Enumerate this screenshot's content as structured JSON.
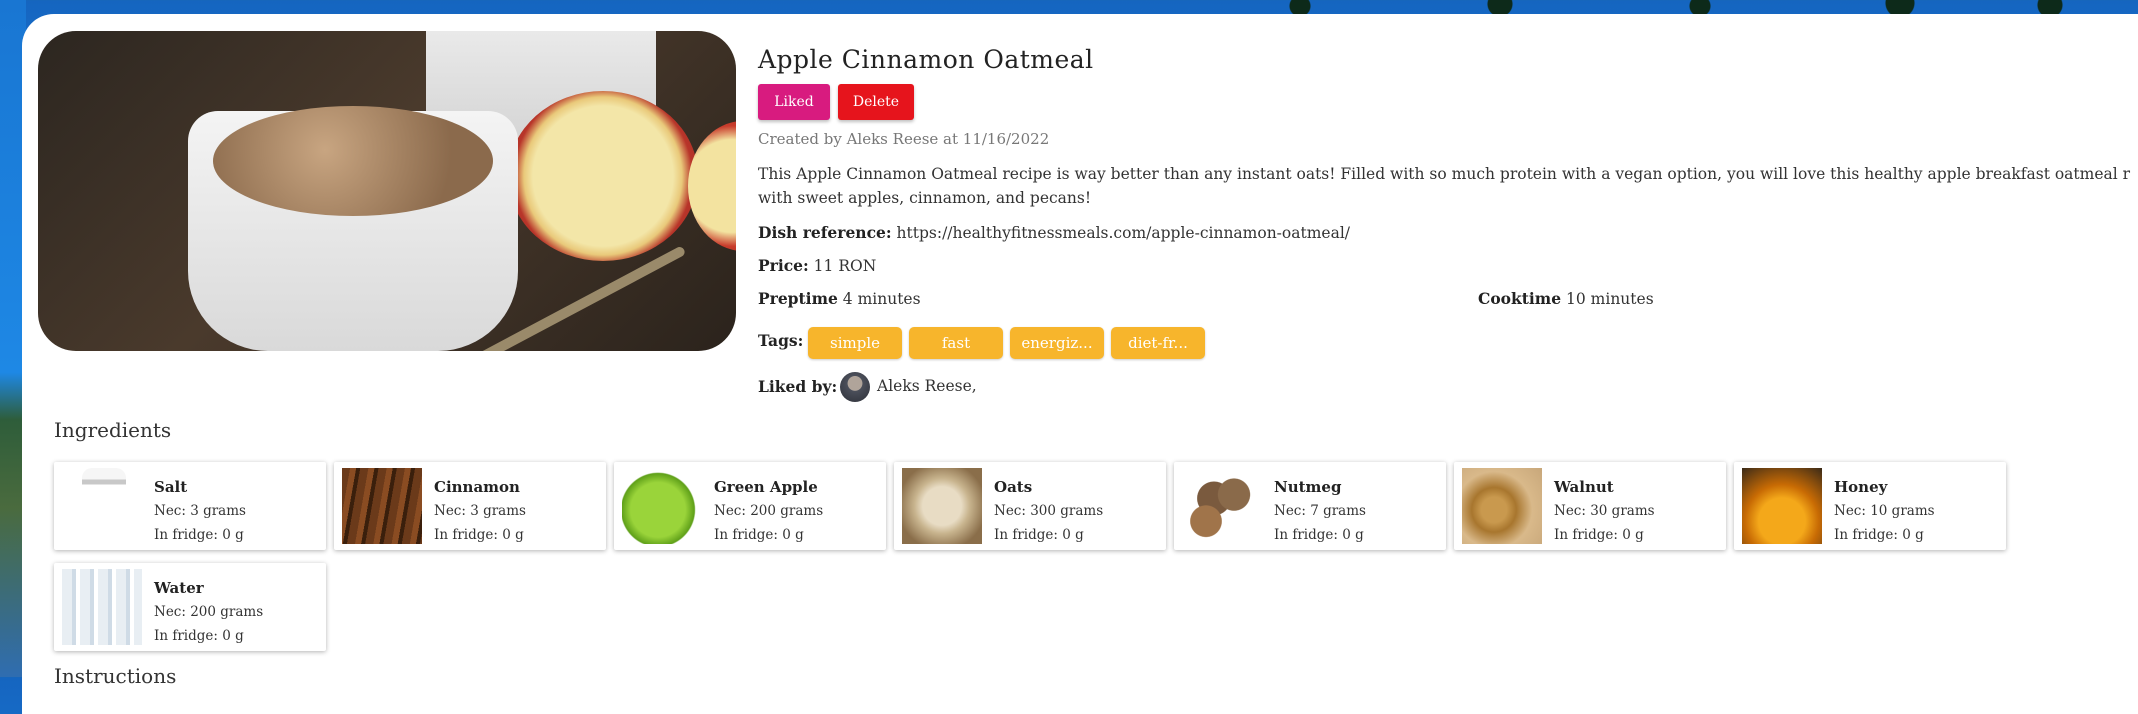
{
  "recipe": {
    "title": "Apple Cinnamon Oatmeal",
    "liked_button": "Liked",
    "delete_button": "Delete",
    "created": "Created by Aleks Reese at 11/16/2022",
    "description_line1": "This Apple Cinnamon Oatmeal recipe is way better than any instant oats! Filled with so much protein with a vegan option, you will love this healthy apple breakfast oatmeal r",
    "description_line2": "with sweet apples, cinnamon, and pecans!",
    "dish_reference_label": "Dish reference:",
    "dish_reference_value": "https://healthyfitnessmeals.com/apple-cinnamon-oatmeal/",
    "price_label": "Price:",
    "price_value": "11 RON",
    "preptime_label": "Preptime",
    "preptime_value": "4 minutes",
    "cooktime_label": "Cooktime",
    "cooktime_value": "10 minutes",
    "tags_label": "Tags:",
    "tags": [
      "simple",
      "fast",
      "energiz...",
      "diet-fr..."
    ],
    "liked_by_label": "Liked by:",
    "liked_by": [
      "Aleks Reese,"
    ]
  },
  "ingredients_title": "Ingredients",
  "instructions_title": "Instructions",
  "ingredients": [
    {
      "name": "Salt",
      "nec": "Nec: 3 grams",
      "fridge": "In fridge: 0 g",
      "icon": "salt-shaker-image"
    },
    {
      "name": "Cinnamon",
      "nec": "Nec: 3 grams",
      "fridge": "In fridge: 0 g",
      "icon": "cinnamon-image"
    },
    {
      "name": "Green Apple",
      "nec": "Nec: 200 grams",
      "fridge": "In fridge: 0 g",
      "icon": "green-apple-image"
    },
    {
      "name": "Oats",
      "nec": "Nec: 300 grams",
      "fridge": "In fridge: 0 g",
      "icon": "oats-image"
    },
    {
      "name": "Nutmeg",
      "nec": "Nec: 7 grams",
      "fridge": "In fridge: 0 g",
      "icon": "nutmeg-image"
    },
    {
      "name": "Walnut",
      "nec": "Nec: 30 grams",
      "fridge": "In fridge: 0 g",
      "icon": "walnut-image"
    },
    {
      "name": "Honey",
      "nec": "Nec: 10 grams",
      "fridge": "In fridge: 0 g",
      "icon": "honey-image"
    },
    {
      "name": "Water",
      "nec": "Nec: 200 grams",
      "fridge": "In fridge: 0 g",
      "icon": "water-bottles-image"
    }
  ],
  "colors": {
    "liked": "#d81b7f",
    "delete": "#e6141c",
    "tag": "#f7b52c"
  }
}
